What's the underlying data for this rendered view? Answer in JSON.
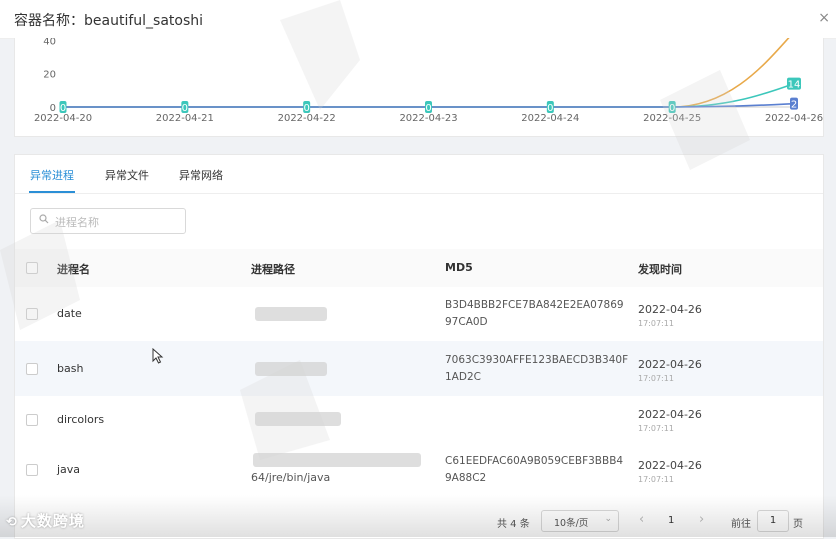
{
  "dialog": {
    "title": "容器名称：beautiful_satoshi",
    "close_glyph": "×"
  },
  "chart_data": {
    "type": "line",
    "title": "",
    "xlabel": "",
    "ylabel": "",
    "x": [
      "2022-04-20",
      "2022-04-21",
      "2022-04-22",
      "2022-04-23",
      "2022-04-24",
      "2022-04-25",
      "2022-04-26"
    ],
    "y_ticks_visible": [
      0,
      20,
      40
    ],
    "ylim": [
      0,
      45
    ],
    "series": [
      {
        "color": "#e8a94a",
        "values": [
          0,
          0,
          0,
          0,
          0,
          0,
          45
        ]
      },
      {
        "color": "#3cc7bb",
        "values": [
          0,
          0,
          0,
          0,
          0,
          0,
          14
        ]
      },
      {
        "color": "#5a7fd0",
        "values": [
          0,
          0,
          0,
          0,
          0,
          0,
          2
        ]
      }
    ],
    "point_labels_teal": [
      "0",
      "0",
      "0",
      "0",
      "0",
      "0",
      "14"
    ],
    "point_labels_blue_last": "2"
  },
  "tabs": [
    {
      "label": "异常进程",
      "active": true
    },
    {
      "label": "异常文件",
      "active": false
    },
    {
      "label": "异常网络",
      "active": false
    }
  ],
  "search": {
    "placeholder": "进程名称",
    "value": ""
  },
  "table": {
    "headers": [
      "进程名",
      "进程路径",
      "MD5",
      "发现时间"
    ],
    "rows": [
      {
        "name": "date",
        "path": "",
        "md5": "B3D4BBB2FCE7BA842E2EA07869 97CA0D",
        "date": "2022-04-26",
        "time": "17:07:11"
      },
      {
        "name": "bash",
        "path": "",
        "md5": "7063C3930AFFE123BAECD3B340F 1AD2C",
        "date": "2022-04-26",
        "time": "17:07:11"
      },
      {
        "name": "dircolors",
        "path": "",
        "md5": "",
        "date": "2022-04-26",
        "time": "17:07:11"
      },
      {
        "name": "java",
        "path": "64/jre/bin/java",
        "md5": "C61EEDFAC60A9B059CEBF3BBB4 9A88C2",
        "date": "2022-04-26",
        "time": "17:07:11"
      }
    ]
  },
  "pagination": {
    "total": "共 4 条",
    "page_size": "10条/页",
    "current_page": "1",
    "goto_prefix": "前往",
    "goto_value": "1",
    "goto_suffix": "页",
    "prev_glyph": "‹",
    "next_glyph": "›"
  },
  "watermark": {
    "brand": "大数跨境"
  }
}
